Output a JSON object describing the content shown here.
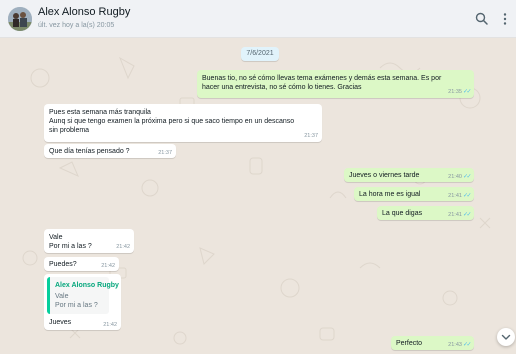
{
  "header": {
    "name": "Alex Alonso Rugby",
    "status": "últ. vez hoy a la(s) 20:05"
  },
  "date_chip": "7/6/2021",
  "messages": [
    {
      "dir": "out",
      "lines": [
        "Buenas tio, no sé cómo llevas tema exámenes y demás esta semana. Es por",
        "hacer una entrevista, no sé cómo lo tienes. Gracias"
      ],
      "time": "21:35"
    },
    {
      "dir": "in",
      "lines": [
        "Pues esta semana más tranquila",
        "Aunq si que tengo examen la próxima pero si que saco tiempo en un descanso",
        "sin problema"
      ],
      "time": "21:37"
    },
    {
      "dir": "in",
      "lines": [
        "Que día tenías pensado ?"
      ],
      "time": "21:37"
    },
    {
      "dir": "out",
      "lines": [
        "Jueves o viernes tarde"
      ],
      "time": "21:40"
    },
    {
      "dir": "out",
      "lines": [
        "La hora me es igual"
      ],
      "time": "21:41"
    },
    {
      "dir": "out",
      "lines": [
        "La que digas"
      ],
      "time": "21:41"
    },
    {
      "dir": "in",
      "lines": [
        "Vale",
        "Por mi a las ?"
      ],
      "time": "21:42"
    },
    {
      "dir": "in",
      "lines": [
        "Puedes?"
      ],
      "time": "21:42"
    },
    {
      "dir": "in",
      "quote": {
        "author": "Alex Alonso Rugby",
        "lines": [
          "Vale",
          "Por mi a las ?"
        ]
      },
      "lines": [
        "Jueves"
      ],
      "time": "21:42"
    },
    {
      "dir": "out",
      "lines": [
        "Perfecto"
      ],
      "time": "21:43"
    }
  ],
  "icons": {
    "search": "search-icon",
    "menu": "kebab-menu-icon",
    "scroll": "chevron-down-icon",
    "read_receipt": "double-check-icon"
  },
  "colors": {
    "header_bg": "#f0f2f5",
    "chat_bg": "#ece5dd",
    "incoming_bubble": "#ffffff",
    "outgoing_bubble": "#dcf8c6",
    "read_ticks": "#53bdeb",
    "quote_accent": "#06cf9c",
    "date_chip_bg": "#e1f3fb"
  }
}
